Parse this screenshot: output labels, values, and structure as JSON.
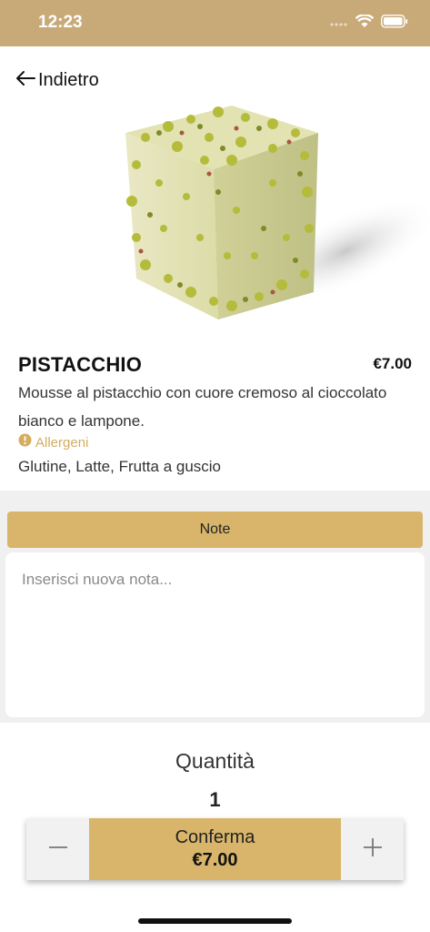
{
  "status_bar": {
    "time": "12:23"
  },
  "nav": {
    "back_label": "Indietro"
  },
  "product": {
    "name": "PISTACCHIO",
    "price": "€7.00",
    "description": "Mousse al pistacchio con cuore cremoso al cioccolato bianco e lampone.",
    "allergen_label": "Allergeni",
    "allergens": "Glutine, Latte, Frutta a guscio"
  },
  "notes": {
    "header": "Note",
    "placeholder": "Inserisci nuova nota...",
    "value": ""
  },
  "quantity": {
    "title": "Quantità",
    "value": "1"
  },
  "actions": {
    "confirm_label": "Conferma",
    "confirm_price": "€7.00",
    "decrement_icon": "minus-icon",
    "increment_icon": "plus-icon"
  },
  "colors": {
    "header_bg": "#c8a978",
    "accent": "#d8b56a",
    "allergen": "#d4ad5f",
    "panel_bg": "#f0f0f0"
  }
}
